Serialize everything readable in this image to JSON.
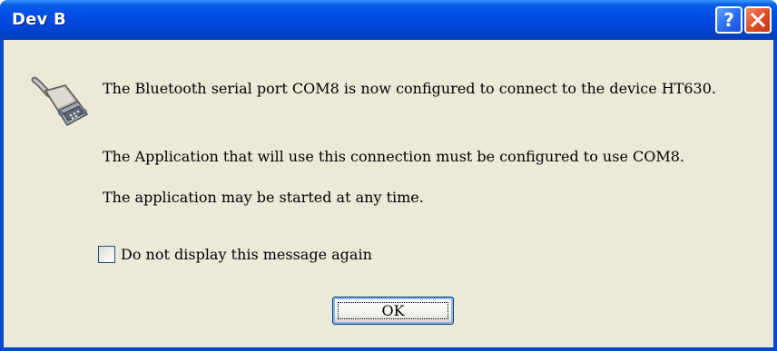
{
  "window": {
    "title": "Dev B"
  },
  "titlebar_buttons": {
    "help_glyph": "?",
    "help_icon": "help-icon",
    "close_icon": "close-icon"
  },
  "messages": {
    "line1": "The Bluetooth serial port COM8 is now configured to connect to the device HT630.",
    "line2": "The Application that will use this connection must be configured to use COM8.",
    "line3": "The application may be started at any time."
  },
  "checkbox": {
    "label": "Do not display this message again",
    "checked": false
  },
  "ok_button": {
    "label": "OK"
  },
  "colors": {
    "titlebar": "#0050E8",
    "client": "#ECE9D8",
    "close": "#DF4B22"
  }
}
